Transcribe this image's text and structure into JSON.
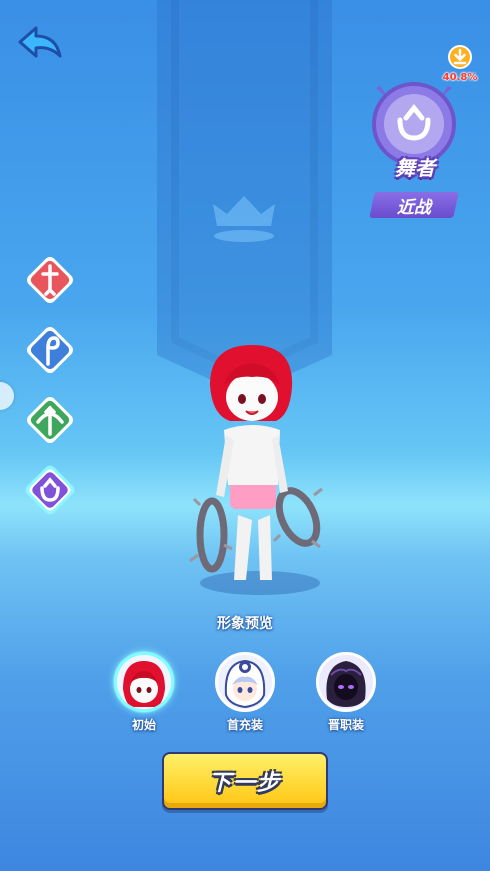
{
  "header": {
    "back_icon": "back-arrow-icon",
    "download_icon": "download-icon",
    "download_progress": "40.8%"
  },
  "selected_class": {
    "name": "舞者",
    "type": "近战",
    "icon": "dancer-crest-icon",
    "accent": "#7a5be0"
  },
  "class_list": [
    {
      "icon": "sword-icon",
      "color": "#e8555c",
      "selected": false
    },
    {
      "icon": "staff-icon",
      "color": "#3f7fdc",
      "selected": false
    },
    {
      "icon": "bow-icon",
      "color": "#3ea75d",
      "selected": false
    },
    {
      "icon": "dancer-crest-icon",
      "color": "#8052d8",
      "selected": true
    }
  ],
  "preview": {
    "label": "形象预览"
  },
  "skins": [
    {
      "label": "初始",
      "selected": true
    },
    {
      "label": "首充装",
      "selected": false
    },
    {
      "label": "晋职装",
      "selected": false
    }
  ],
  "actions": {
    "next_label": "下一步",
    "next_color": "#ffd938"
  }
}
